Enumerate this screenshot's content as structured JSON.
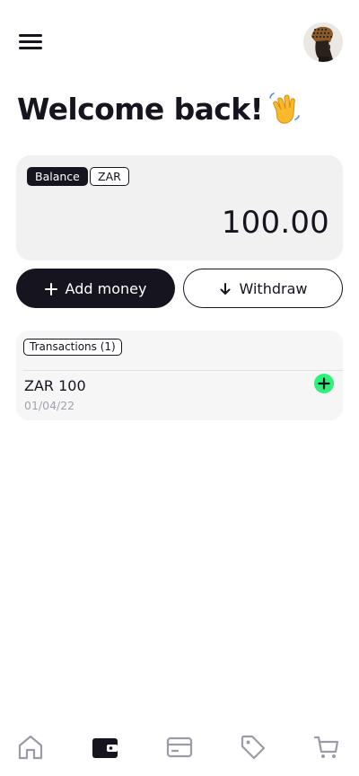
{
  "header": {
    "menu_icon": "hamburger-menu-icon",
    "avatar_icon": "user-avatar"
  },
  "greeting": {
    "text": "Welcome back!",
    "emoji_icon": "waving-hand-icon"
  },
  "balance": {
    "label": "Balance",
    "currency": "ZAR",
    "amount": "100.00"
  },
  "actions": {
    "add_label": "Add money",
    "add_icon": "plus-icon",
    "withdraw_label": "Withdraw",
    "withdraw_icon": "arrow-down-icon"
  },
  "transactions": {
    "title": "Transactions (1)",
    "items": [
      {
        "amount": "ZAR 100",
        "date": "01/04/22",
        "type_icon": "plus-circle-icon"
      }
    ]
  },
  "nav": {
    "items": [
      {
        "icon": "home-icon",
        "active": false
      },
      {
        "icon": "wallet-icon",
        "active": true
      },
      {
        "icon": "card-icon",
        "active": false
      },
      {
        "icon": "tag-icon",
        "active": false
      },
      {
        "icon": "cart-icon",
        "active": false
      }
    ]
  },
  "colors": {
    "primary": "#15141f",
    "accent_green": "#2ef07a",
    "card_bg": "#f1f1f1",
    "muted_text": "#a3a3ad",
    "nav_inactive": "#9b9aa6"
  }
}
